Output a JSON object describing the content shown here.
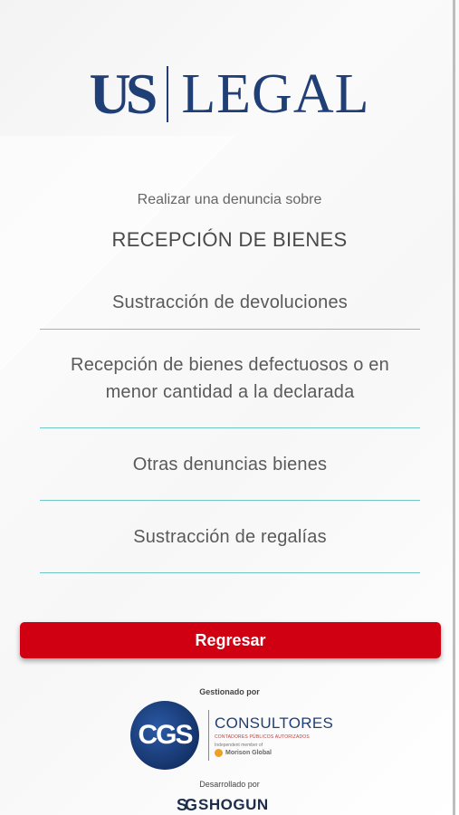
{
  "brand": {
    "logo_left": "US",
    "logo_right": "LEGAL",
    "primary_color": "#1f3f76"
  },
  "header": {
    "intro": "Realizar una denuncia sobre",
    "section_title": "RECEPCIÓN DE BIENES"
  },
  "options": [
    {
      "label": "Sustracción de devoluciones"
    },
    {
      "label": "Recepción de bienes defectuosos o en menor cantidad a la declarada"
    },
    {
      "label": "Otras denuncias bienes"
    },
    {
      "label": "Sustracción de regalías"
    }
  ],
  "actions": {
    "back_label": "Regresar",
    "back_color": "#d00012"
  },
  "footer": {
    "managed_by": "Gestionado por",
    "cgs": {
      "mark": "CGS",
      "name": "CONSULTORES",
      "subtitle": "CONTADORES PÚBLICOS AUTORIZADOS",
      "member_note": "Independent member of",
      "network": "Morison Global"
    },
    "developed_by": "Desarrollado por",
    "developer": {
      "mark": "SG",
      "name": "SHOGUN"
    }
  },
  "divider_color": "#6fc8c6"
}
